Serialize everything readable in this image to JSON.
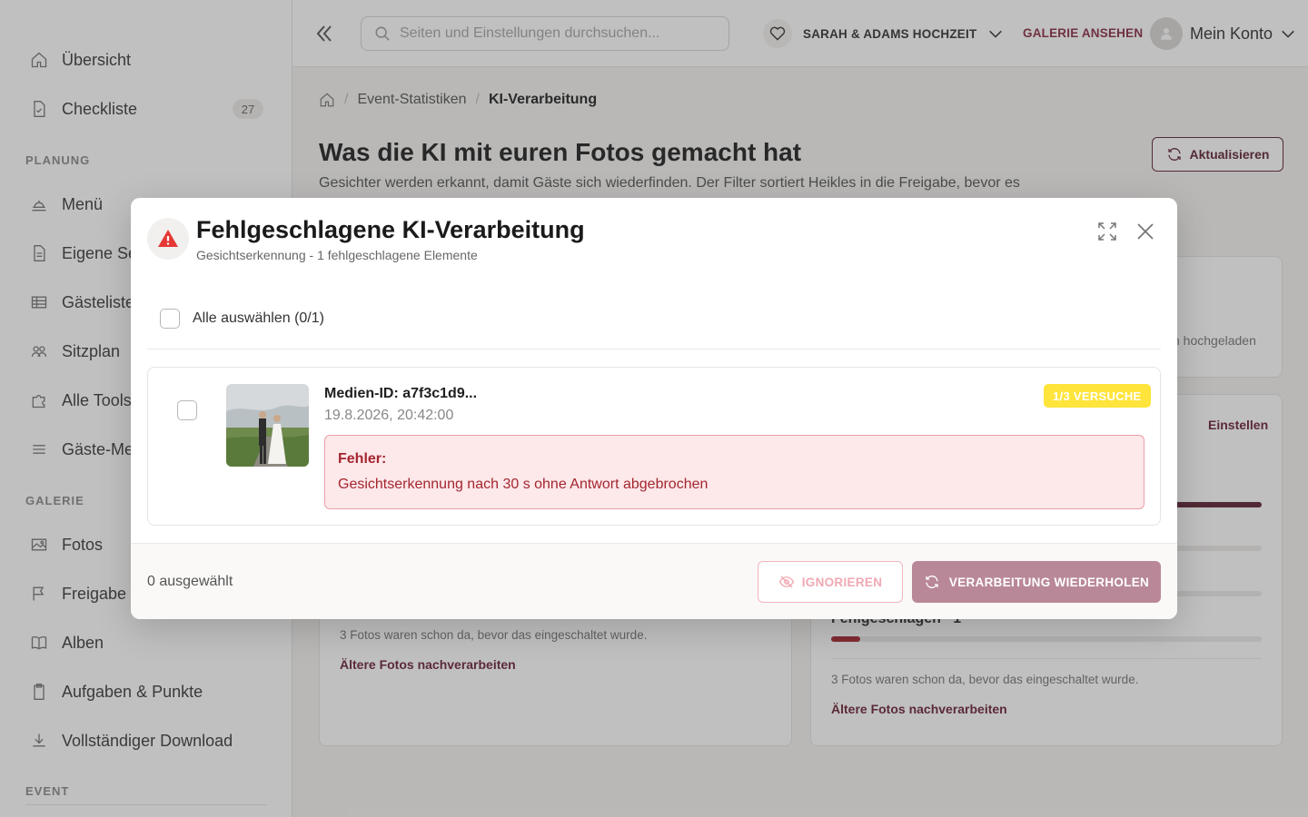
{
  "sidebar": {
    "items": [
      {
        "label": "Übersicht",
        "icon": "home-icon"
      },
      {
        "label": "Checkliste",
        "icon": "checklist-icon",
        "count": "27"
      },
      {
        "label": "Menü",
        "icon": "menu-food-icon"
      },
      {
        "label": "Eigene Se",
        "icon": "page-icon"
      },
      {
        "label": "Gästeliste",
        "icon": "table-icon"
      },
      {
        "label": "Sitzplan",
        "icon": "people-icon"
      },
      {
        "label": "Alle Tools",
        "icon": "puzzle-icon"
      },
      {
        "label": "Gäste-Me",
        "icon": "list-icon"
      },
      {
        "label": "Fotos",
        "icon": "image-icon"
      },
      {
        "label": "Freigabe",
        "icon": "flag-icon"
      },
      {
        "label": "Alben",
        "icon": "book-icon"
      },
      {
        "label": "Aufgaben & Punkte",
        "icon": "clipboard-icon"
      },
      {
        "label": "Vollständiger Download",
        "icon": "download-icon"
      }
    ],
    "sections": {
      "planung": "PLANUNG",
      "galerie": "GALERIE",
      "event": "EVENT"
    }
  },
  "topbar": {
    "search_placeholder": "Seiten und Einstellungen durchsuchen...",
    "event_name": "SARAH & ADAMS HOCHZEIT",
    "gallery_link": "GALERIE ANSEHEN",
    "account_label": "Mein Konto"
  },
  "breadcrumb": {
    "crumb1": "Event-Statistiken",
    "current": "KI-Verarbeitung"
  },
  "page": {
    "title": "Was die KI mit euren Fotos gemacht hat",
    "description": "Gesichter werden erkannt, damit Gäste sich wiederfinden. Der Filter sortiert Heikles in die Freigabe, bevor es",
    "refresh_label": "Aktualisieren"
  },
  "background_cards": {
    "right_top_text": "n hochgeladen",
    "right_settings_link": "Einstellen",
    "left_note": "3 Fotos waren schon da, bevor das eingeschaltet wurde.",
    "left_link": "Ältere Fotos nachverarbeiten",
    "right_failed_label": "Fehlgeschlagen",
    "right_failed_count": "1",
    "right_note": "3 Fotos waren schon da, bevor das eingeschaltet wurde.",
    "right_link": "Ältere Fotos nachverarbeiten"
  },
  "modal": {
    "title": "Fehlgeschlagene KI-Verarbeitung",
    "subtitle": "Gesichtserkennung - 1 fehlgeschlagene Elemente",
    "select_all_label": "Alle auswählen (0/1)",
    "item": {
      "media_id": "Medien-ID: a7f3c1d9...",
      "date": "19.8.2026, 20:42:00",
      "attempts_badge": "1/3 VERSUCHE",
      "error_label": "Fehler:",
      "error_message": "Gesichtserkennung nach 30 s ohne Antwort abgebrochen"
    },
    "footer": {
      "selected_count": "0 ausgewählt",
      "ignore_label": "IGNORIEREN",
      "retry_label": "VERARBEITUNG WIEDERHOLEN"
    }
  },
  "colors": {
    "brand": "#5e2233",
    "accent_link": "#8a2d45",
    "error_text": "#a4262f",
    "error_bg": "#fde8ea",
    "badge_yellow": "#ffe43b",
    "retry_button": "#b98898"
  }
}
